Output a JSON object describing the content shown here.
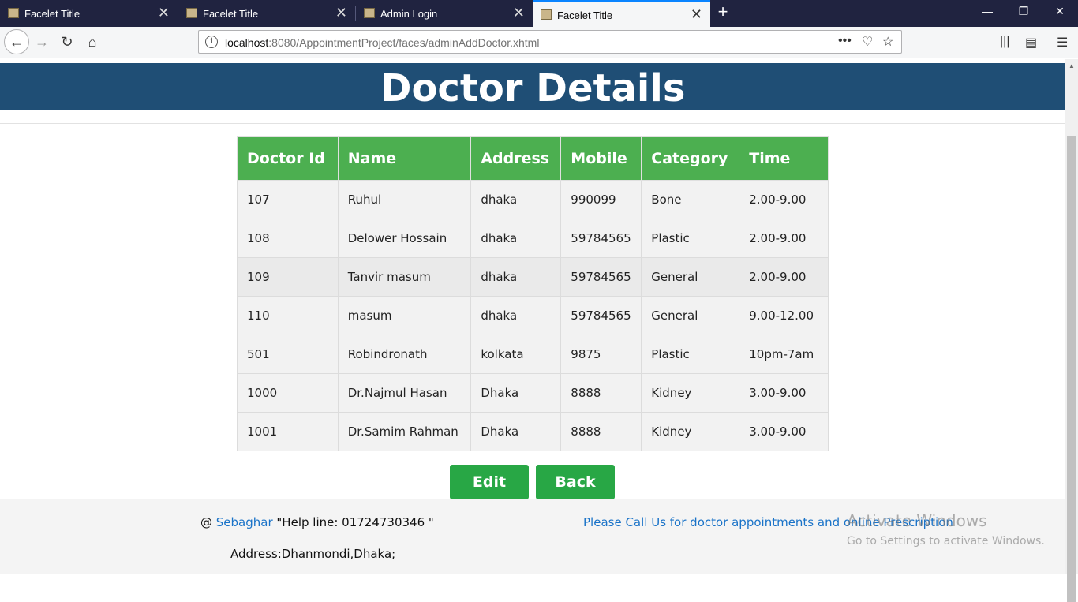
{
  "browser": {
    "tabs": [
      {
        "label": "Facelet Title",
        "active": false
      },
      {
        "label": "Facelet Title",
        "active": false
      },
      {
        "label": "Admin Login",
        "active": false
      },
      {
        "label": "Facelet Title",
        "active": true
      }
    ],
    "url_host": "localhost",
    "url_path": ":8080/AppointmentProject/faces/adminAddDoctor.xhtml"
  },
  "page": {
    "title": "Doctor Details",
    "table": {
      "headers": [
        "Doctor Id",
        "Name",
        "Address",
        "Mobile",
        "Category",
        "Time"
      ],
      "rows": [
        [
          "107",
          "Ruhul",
          "dhaka",
          "990099",
          "Bone",
          "2.00-9.00"
        ],
        [
          "108",
          "Delower Hossain",
          "dhaka",
          "59784565",
          "Plastic",
          "2.00-9.00"
        ],
        [
          "109",
          "Tanvir masum",
          "dhaka",
          "59784565",
          "General",
          "2.00-9.00"
        ],
        [
          "110",
          "masum",
          "dhaka",
          "59784565",
          "General",
          "9.00-12.00"
        ],
        [
          "501",
          "Robindronath",
          "kolkata",
          "9875",
          "Plastic",
          "10pm-7am"
        ],
        [
          "1000",
          "Dr.Najmul Hasan",
          "Dhaka",
          "8888",
          "Kidney",
          "3.00-9.00"
        ],
        [
          "1001",
          "Dr.Samim Rahman",
          "Dhaka",
          "8888",
          "Kidney",
          "3.00-9.00"
        ]
      ]
    },
    "buttons": {
      "edit": "Edit",
      "back": "Back"
    }
  },
  "footer": {
    "at": "@ ",
    "site_link": "Sebaghar",
    "helpline": " \"Help line: 01724730346 \"",
    "call_text": "Please Call Us for doctor appointments and online Prescription",
    "address": "Address:Dhanmondi,Dhaka;"
  },
  "watermark": {
    "line1": "Activate Windows",
    "line2": "Go to Settings to activate Windows."
  },
  "colors": {
    "header_bg": "#1f4e75",
    "table_header_bg": "#4caf50",
    "button_bg": "#28a745",
    "link": "#1a73c8"
  }
}
